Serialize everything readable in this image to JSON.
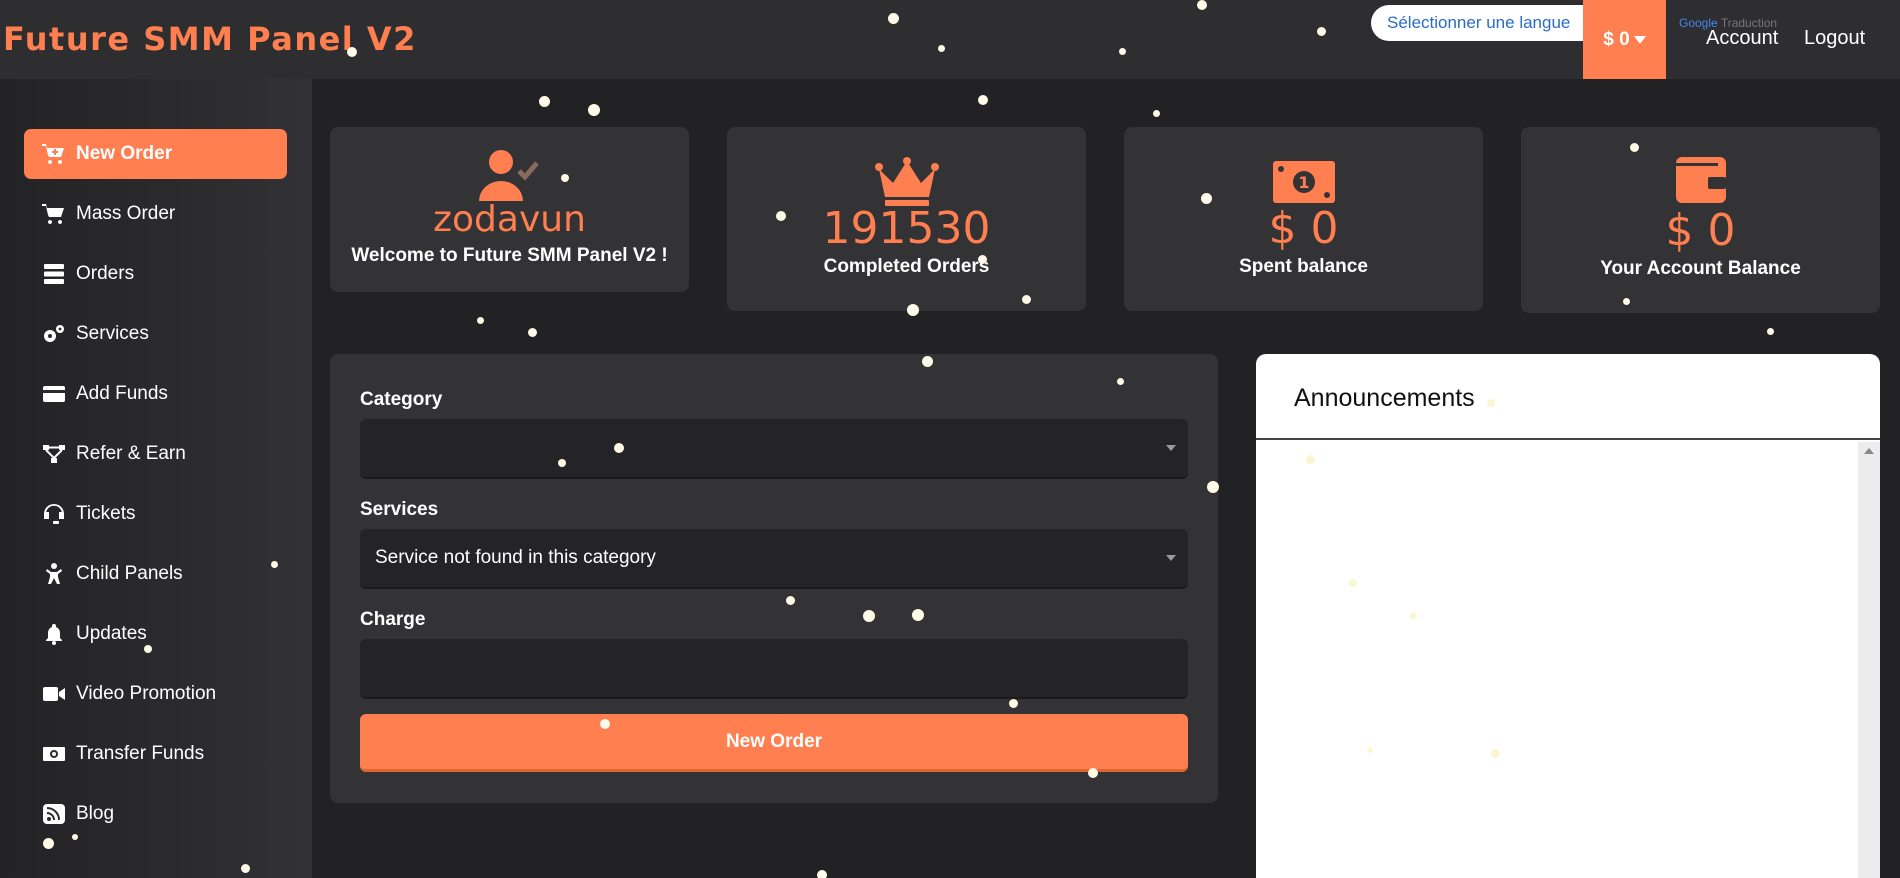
{
  "header": {
    "brand": "Future SMM Panel V2",
    "language_select": "Sélectionner une langue",
    "balance": "$ 0",
    "google_word": "Google",
    "translate_word": "Traduction",
    "account": "Account",
    "logout": "Logout"
  },
  "sidebar": {
    "items": [
      {
        "label": "New Order",
        "icon": "cart-plus-icon",
        "active": true
      },
      {
        "label": "Mass Order",
        "icon": "cart-icon"
      },
      {
        "label": "Orders",
        "icon": "server-icon"
      },
      {
        "label": "Services",
        "icon": "gears-icon"
      },
      {
        "label": "Add Funds",
        "icon": "credit-card-icon"
      },
      {
        "label": "Refer & Earn",
        "icon": "network-icon"
      },
      {
        "label": "Tickets",
        "icon": "headset-icon"
      },
      {
        "label": "Child Panels",
        "icon": "child-icon"
      },
      {
        "label": "Updates",
        "icon": "bell-icon"
      },
      {
        "label": "Video Promotion",
        "icon": "video-icon"
      },
      {
        "label": "Transfer Funds",
        "icon": "money-bill-icon"
      },
      {
        "label": "Blog",
        "icon": "rss-icon"
      }
    ]
  },
  "stats": {
    "user": {
      "value": "zodavun",
      "label": "Welcome to Future SMM Panel V2 !"
    },
    "orders": {
      "value": "191530",
      "label": "Completed Orders"
    },
    "spent": {
      "value": "$ 0",
      "label": "Spent balance"
    },
    "balance": {
      "value": "$ 0",
      "label": "Your Account Balance"
    }
  },
  "order_form": {
    "category_label": "Category",
    "category_value": "",
    "services_label": "Services",
    "services_value": "Service not found in this category",
    "charge_label": "Charge",
    "charge_value": "",
    "submit_label": "New Order"
  },
  "announcements": {
    "title": "Announcements"
  },
  "colors": {
    "accent": "#ff7f50",
    "background": "#222224",
    "card": "#333336"
  }
}
